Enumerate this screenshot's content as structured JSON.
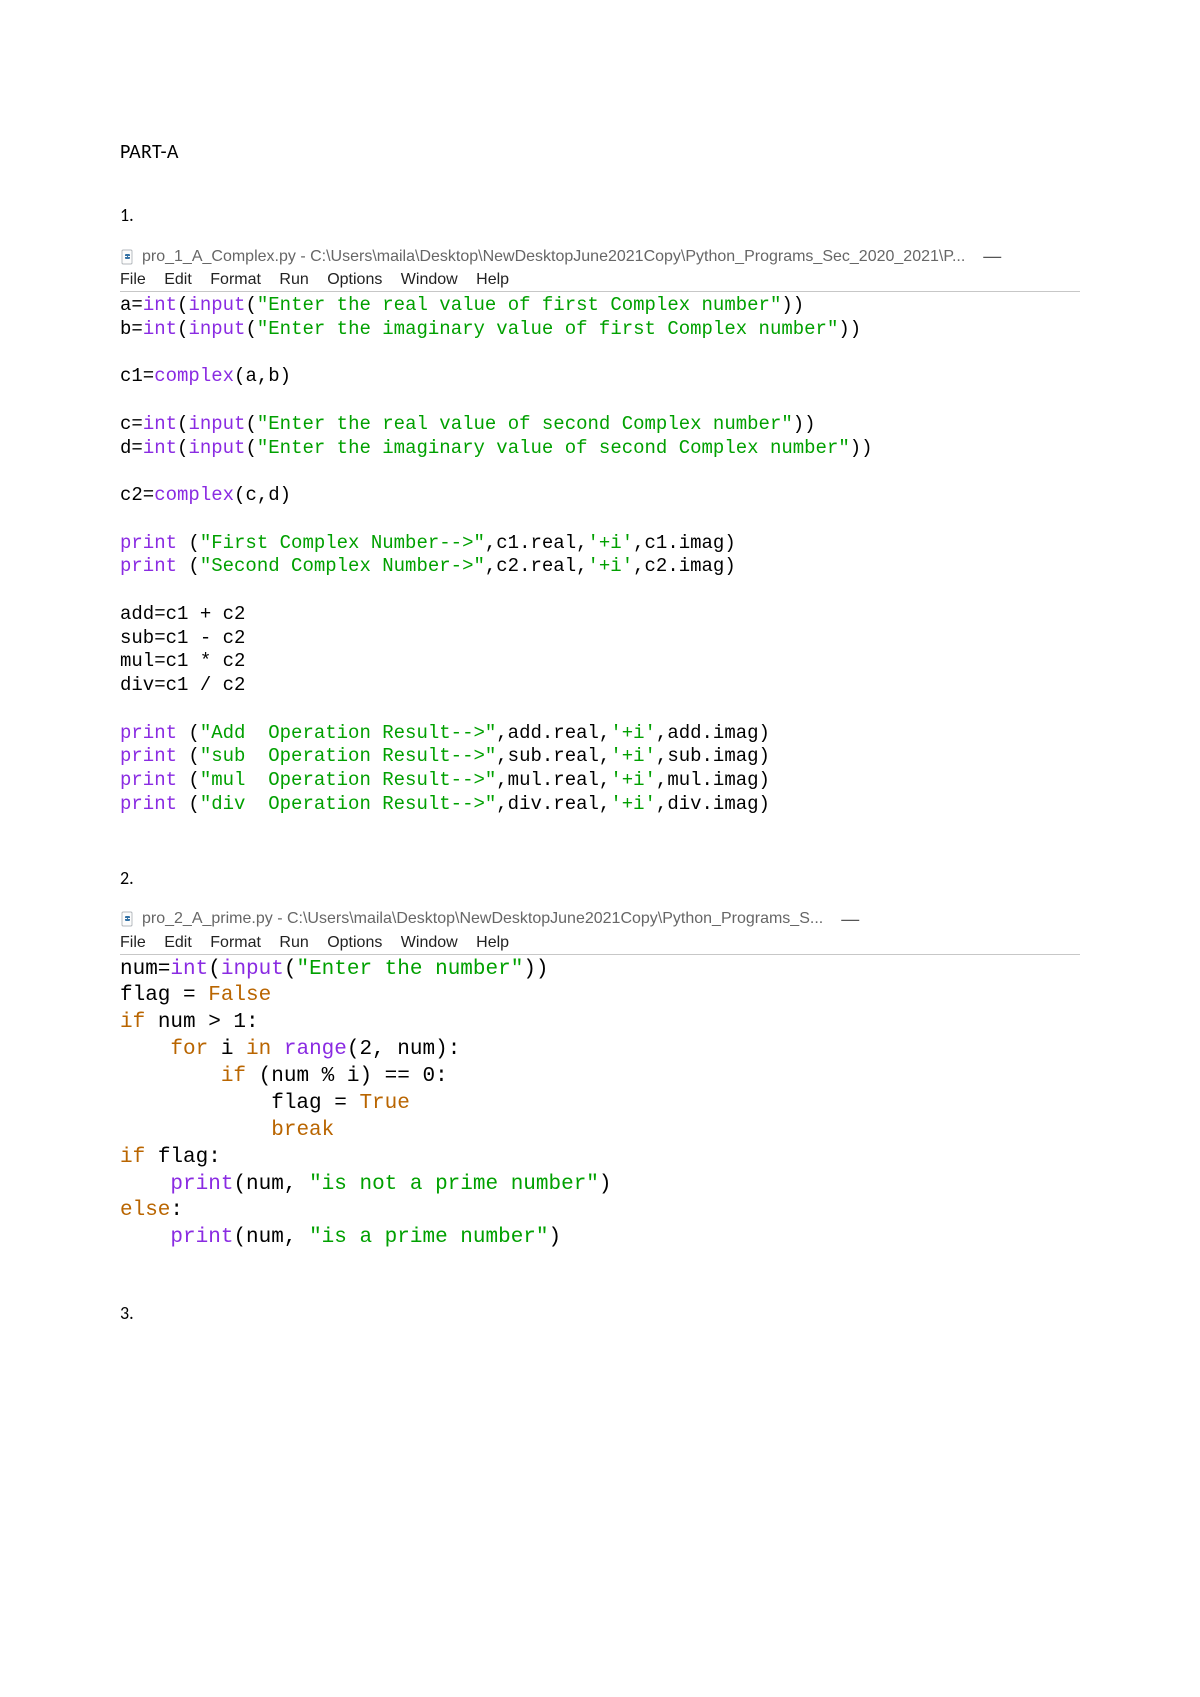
{
  "headings": {
    "part": "PART-A",
    "n1": "1.",
    "n2": "2.",
    "n3": "3."
  },
  "ide1": {
    "title": "pro_1_A_Complex.py - C:\\Users\\maila\\Desktop\\NewDesktopJune2021Copy\\Python_Programs_Sec_2020_2021\\P...",
    "dash": "—",
    "menus": {
      "file": "File",
      "edit": "Edit",
      "format": "Format",
      "run": "Run",
      "options": "Options",
      "window": "Window",
      "help": "Help"
    }
  },
  "code1": {
    "l1_a": "a=",
    "l1_b": "int",
    "l1_c": "(",
    "l1_d": "input",
    "l1_e": "(",
    "l1_f": "\"Enter the real value of first Complex number\"",
    "l1_g": "))",
    "l2_a": "b=",
    "l2_b": "int",
    "l2_c": "(",
    "l2_d": "input",
    "l2_e": "(",
    "l2_f": "\"Enter the imaginary value of first Complex number\"",
    "l2_g": "))",
    "l3_a": "c1=",
    "l3_b": "complex",
    "l3_c": "(a,b)",
    "l4_a": "c=",
    "l4_b": "int",
    "l4_c": "(",
    "l4_d": "input",
    "l4_e": "(",
    "l4_f": "\"Enter the real value of second Complex number\"",
    "l4_g": "))",
    "l5_a": "d=",
    "l5_b": "int",
    "l5_c": "(",
    "l5_d": "input",
    "l5_e": "(",
    "l5_f": "\"Enter the imaginary value of second Complex number\"",
    "l5_g": "))",
    "l6_a": "c2=",
    "l6_b": "complex",
    "l6_c": "(c,d)",
    "l7_a": "print",
    "l7_b": " (",
    "l7_c": "\"First Complex Number-->\"",
    "l7_d": ",c1.real,",
    "l7_e": "'+i'",
    "l7_f": ",c1.imag)",
    "l8_a": "print",
    "l8_b": " (",
    "l8_c": "\"Second Complex Number->\"",
    "l8_d": ",c2.real,",
    "l8_e": "'+i'",
    "l8_f": ",c2.imag)",
    "l9": "add=c1 + c2",
    "l10": "sub=c1 - c2",
    "l11": "mul=c1 * c2",
    "l12": "div=c1 / c2",
    "l13_a": "print",
    "l13_b": " (",
    "l13_c": "\"Add  Operation Result-->\"",
    "l13_d": ",add.real,",
    "l13_e": "'+i'",
    "l13_f": ",add.imag)",
    "l14_a": "print",
    "l14_b": " (",
    "l14_c": "\"sub  Operation Result-->\"",
    "l14_d": ",sub.real,",
    "l14_e": "'+i'",
    "l14_f": ",sub.imag)",
    "l15_a": "print",
    "l15_b": " (",
    "l15_c": "\"mul  Operation Result-->\"",
    "l15_d": ",mul.real,",
    "l15_e": "'+i'",
    "l15_f": ",mul.imag)",
    "l16_a": "print",
    "l16_b": " (",
    "l16_c": "\"div  Operation Result-->\"",
    "l16_d": ",div.real,",
    "l16_e": "'+i'",
    "l16_f": ",div.imag)"
  },
  "ide2": {
    "title": "pro_2_A_prime.py - C:\\Users\\maila\\Desktop\\NewDesktopJune2021Copy\\Python_Programs_S...",
    "dash": "—",
    "menus": {
      "file": "File",
      "edit": "Edit",
      "format": "Format",
      "run": "Run",
      "options": "Options",
      "window": "Window",
      "help": "Help"
    }
  },
  "code2": {
    "l1_a": "num=",
    "l1_b": "int",
    "l1_c": "(",
    "l1_d": "input",
    "l1_e": "(",
    "l1_f": "\"Enter the number\"",
    "l1_g": "))",
    "l2_a": "flag = ",
    "l2_b": "False",
    "l3_a": "if",
    "l3_b": " num > 1:",
    "l4_a": "    ",
    "l4_b": "for",
    "l4_c": " i ",
    "l4_d": "in",
    "l4_e": " ",
    "l4_f": "range",
    "l4_g": "(2, num):",
    "l5_a": "        ",
    "l5_b": "if",
    "l5_c": " (num % i) == 0:",
    "l6_a": "            flag = ",
    "l6_b": "True",
    "l7_a": "            ",
    "l7_b": "break",
    "l8_a": "if",
    "l8_b": " flag:",
    "l9_a": "    ",
    "l9_b": "print",
    "l9_c": "(num, ",
    "l9_d": "\"is not a prime number\"",
    "l9_e": ")",
    "l10_a": "else",
    "l10_b": ":",
    "l11_a": "    ",
    "l11_b": "print",
    "l11_c": "(num, ",
    "l11_d": "\"is a prime number\"",
    "l11_e": ")"
  }
}
